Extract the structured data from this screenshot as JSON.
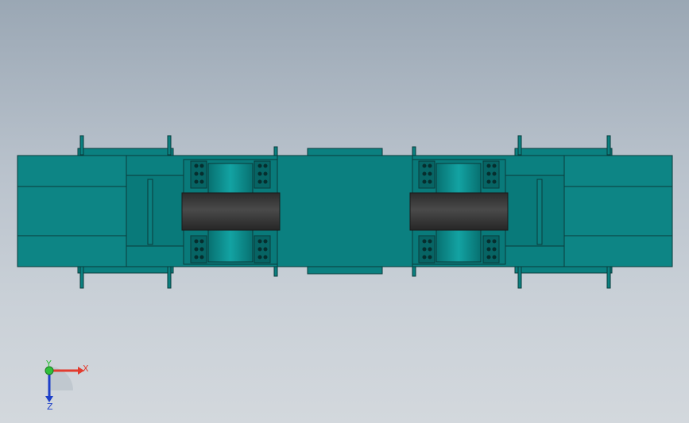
{
  "viewport": {
    "model_colors": {
      "body": "#0b8080",
      "body_dark": "#076464",
      "edge": "#0a3b3b",
      "roller": "#3a3a3a",
      "background_top": "#9aa7b4",
      "background_bottom": "#d3d8dd"
    }
  },
  "triad": {
    "x_label": "X",
    "y_label": "Y",
    "z_label": "Z",
    "x_color": "#e23b2e",
    "y_color": "#2fbf3a",
    "z_color": "#1d3fc8"
  }
}
